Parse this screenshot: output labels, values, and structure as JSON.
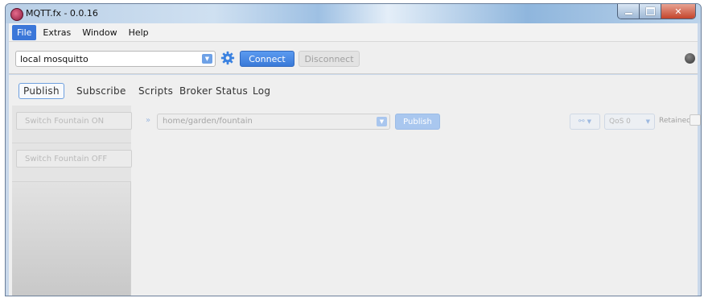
{
  "window": {
    "title": "MQTT.fx - 0.0.16"
  },
  "menubar": {
    "items": [
      "File",
      "Extras",
      "Window",
      "Help"
    ]
  },
  "toolbar": {
    "profile_value": "local mosquitto",
    "connect_label": "Connect",
    "disconnect_label": "Disconnect"
  },
  "tabs": [
    "Publish",
    "Subscribe",
    "Scripts",
    "Broker Status",
    "Log"
  ],
  "sidebar": {
    "buttons": [
      "Switch Fountain ON",
      "Switch Fountain OFF"
    ]
  },
  "publish": {
    "topic_value": "home/garden/fountain",
    "publish_label": "Publish",
    "qos_value": "QoS 0",
    "retained_label": "Retained"
  },
  "colors": {
    "accent": "#3b77d9",
    "connect_button": "#4a8ae4",
    "disabled_text": "#b9b9b9"
  },
  "icons": {
    "app": "mqttfx-app-icon",
    "settings": "gear-icon",
    "status": "connection-status-icon",
    "expand": "double-chevron-right-icon",
    "link": "link-icon"
  }
}
